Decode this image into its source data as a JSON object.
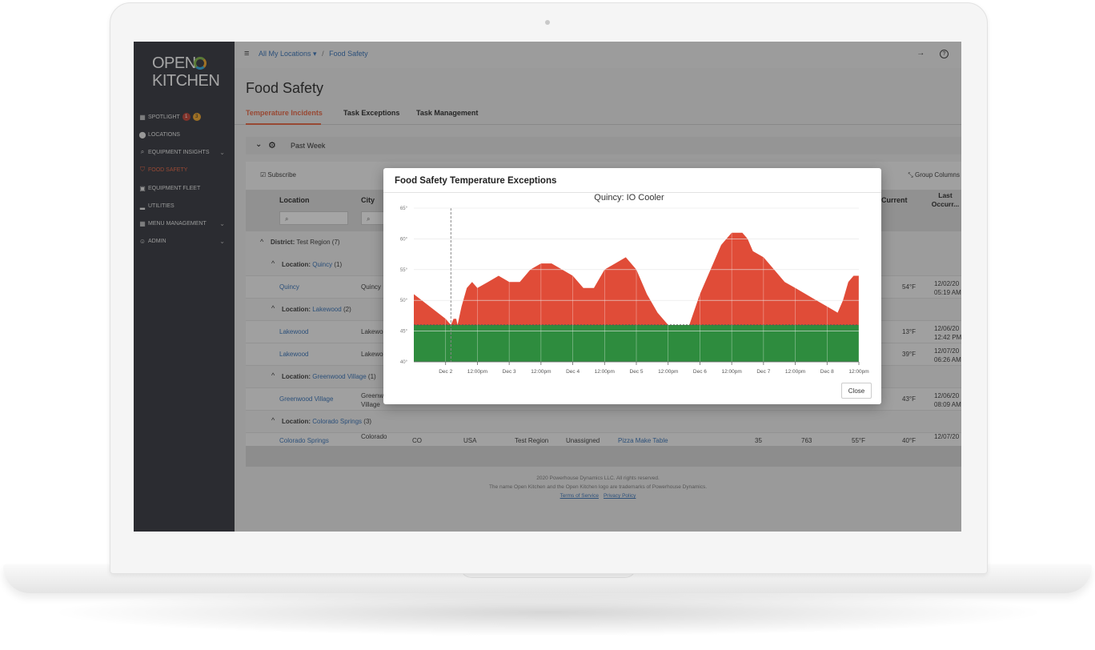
{
  "app": {
    "logo_line1": "OPEN",
    "logo_line2": "KITCHEN"
  },
  "sidebar": {
    "items": [
      {
        "label": "SPOTLIGHT",
        "icon": "spotlight-icon",
        "badges": [
          "1",
          "3"
        ]
      },
      {
        "label": "LOCATIONS",
        "icon": "map-pin-icon"
      },
      {
        "label": "EQUIPMENT INSIGHTS",
        "icon": "search-icon",
        "expandable": true
      },
      {
        "label": "FOOD SAFETY",
        "icon": "shield-icon",
        "active": true
      },
      {
        "label": "EQUIPMENT FLEET",
        "icon": "fleet-icon"
      },
      {
        "label": "UTILITIES",
        "icon": "bar-chart-icon"
      },
      {
        "label": "MENU MANAGEMENT",
        "icon": "grid-icon",
        "expandable": true
      },
      {
        "label": "ADMIN",
        "icon": "users-icon",
        "expandable": true
      }
    ]
  },
  "breadcrumb": {
    "root": "All My Locations",
    "separator": "/",
    "current": "Food Safety"
  },
  "page_title": "Food Safety",
  "tabs": [
    {
      "label": "Temperature Incidents",
      "active": true
    },
    {
      "label": "Task Exceptions"
    },
    {
      "label": "Task Management"
    }
  ],
  "filter": {
    "label": "Past Week"
  },
  "toolbar": {
    "subscribe": "Subscribe",
    "group_columns": "Group Columns"
  },
  "table": {
    "headers": {
      "location": "Location",
      "city": "City",
      "current": "Current",
      "last_occurrence": "Last Occurr..."
    },
    "district": {
      "label": "District:",
      "name": "Test Region (7)"
    },
    "groups": [
      {
        "label": "Location:",
        "name": "Quincy",
        "count": "(1)",
        "rows": [
          {
            "location": "Quincy",
            "city": "Quincy",
            "current": "54°F",
            "date": "12/02/20",
            "time": "05:19 AM"
          }
        ]
      },
      {
        "label": "Location:",
        "name": "Lakewood",
        "count": "(2)",
        "rows": [
          {
            "location": "Lakewood",
            "city": "Lakewo",
            "current": "13°F",
            "date": "12/06/20",
            "time": "12:42 PM"
          },
          {
            "location": "Lakewood",
            "city": "Lakewo",
            "current": "39°F",
            "date": "12/07/20",
            "time": "06:26 AM"
          }
        ]
      },
      {
        "label": "Location:",
        "name": "Greenwood Village",
        "count": "(1)",
        "rows": [
          {
            "location": "Greenwood Village",
            "city_l1": "Greenw",
            "city_l2": "Village",
            "current": "43°F",
            "date": "12/06/20",
            "time": "08:09 AM"
          }
        ]
      },
      {
        "label": "Location:",
        "name": "Colorado Springs",
        "count": "(3)",
        "rows": [
          {
            "location": "Colorado Springs",
            "city": "Colorado",
            "state": "CO",
            "country": "USA",
            "region": "Test Region",
            "assignee": "Unassigned",
            "equipment": "Pizza Make Table",
            "n1": "35",
            "n2": "763",
            "threshold": "55°F",
            "current": "40°F",
            "date": "12/07/20"
          }
        ]
      }
    ]
  },
  "footer": {
    "copyright": "2020 Powerhouse Dynamics LLC. All rights reserved.",
    "trademark": "The name Open Kitchen and the Open Kitchen logo are trademarks of Powerhouse Dynamics.",
    "terms": "Terms of Service",
    "privacy": "Privacy Policy"
  },
  "modal": {
    "title": "Food Safety Temperature Exceptions",
    "close_label": "Close"
  },
  "chart_data": {
    "type": "area",
    "title": "Quincy: IO Cooler",
    "x_tick_labels": [
      "Dec 2",
      "12:00pm",
      "Dec 3",
      "12:00pm",
      "Dec 4",
      "12:00pm",
      "Dec 5",
      "12:00pm",
      "Dec 6",
      "12:00pm",
      "Dec 7",
      "12:00pm",
      "Dec 8",
      "12:00pm"
    ],
    "y_tick_labels": [
      "65°",
      "60°",
      "55°",
      "50°",
      "45°",
      "40°"
    ],
    "ylim": [
      40,
      65
    ],
    "xlim_hours": [
      -12,
      156
    ],
    "threshold": 46,
    "colors": {
      "above": "#e04c38",
      "below": "#2e8c3e",
      "threshold_line": "#555555",
      "marker_line": "#888888"
    },
    "marker_hours": 2,
    "series": [
      {
        "x_hours": [
          -12,
          0,
          2,
          3,
          4,
          4.5,
          6,
          8,
          10,
          12,
          16,
          20,
          24,
          28,
          32,
          36,
          40,
          44,
          48,
          52,
          56,
          60,
          64,
          68,
          72,
          76,
          80,
          84,
          88,
          92,
          96,
          100,
          104,
          106,
          108,
          110,
          112,
          114,
          116,
          120,
          124,
          128,
          132,
          136,
          140,
          144,
          148,
          150,
          152,
          154,
          156
        ],
        "values": [
          51,
          47,
          46,
          47,
          47,
          46,
          49,
          52,
          53,
          52,
          53,
          54,
          53,
          53,
          55,
          56,
          56,
          55,
          54,
          52,
          52,
          55,
          56,
          57,
          55,
          51,
          48,
          46,
          45,
          46,
          51,
          55,
          59,
          60,
          61,
          61,
          61,
          60,
          58,
          57,
          55,
          53,
          52,
          51,
          50,
          49,
          48,
          50,
          53,
          54,
          54
        ]
      }
    ]
  }
}
